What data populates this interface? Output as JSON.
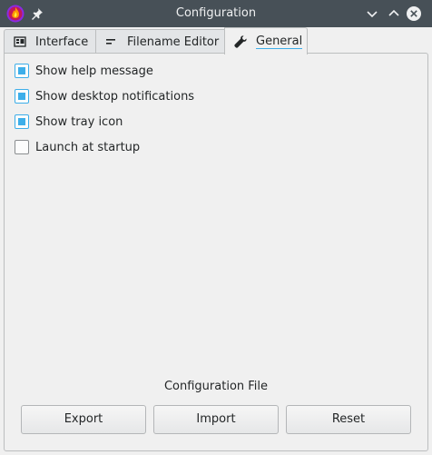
{
  "window": {
    "title": "Configuration"
  },
  "tabs": [
    {
      "label": "Interface",
      "icon": "interface-icon",
      "active": false
    },
    {
      "label": "Filename Editor",
      "icon": "filename-editor-icon",
      "active": false
    },
    {
      "label": "General",
      "icon": "wrench-icon",
      "active": true
    }
  ],
  "options": [
    {
      "label": "Show help message",
      "checked": true
    },
    {
      "label": "Show desktop notifications",
      "checked": true
    },
    {
      "label": "Show tray icon",
      "checked": true
    },
    {
      "label": "Launch at startup",
      "checked": false
    }
  ],
  "config_file": {
    "title": "Configuration File",
    "export_label": "Export",
    "import_label": "Import",
    "reset_label": "Reset"
  },
  "colors": {
    "titlebar": "#475057",
    "accent": "#3daee9",
    "background": "#f0f0f0"
  }
}
